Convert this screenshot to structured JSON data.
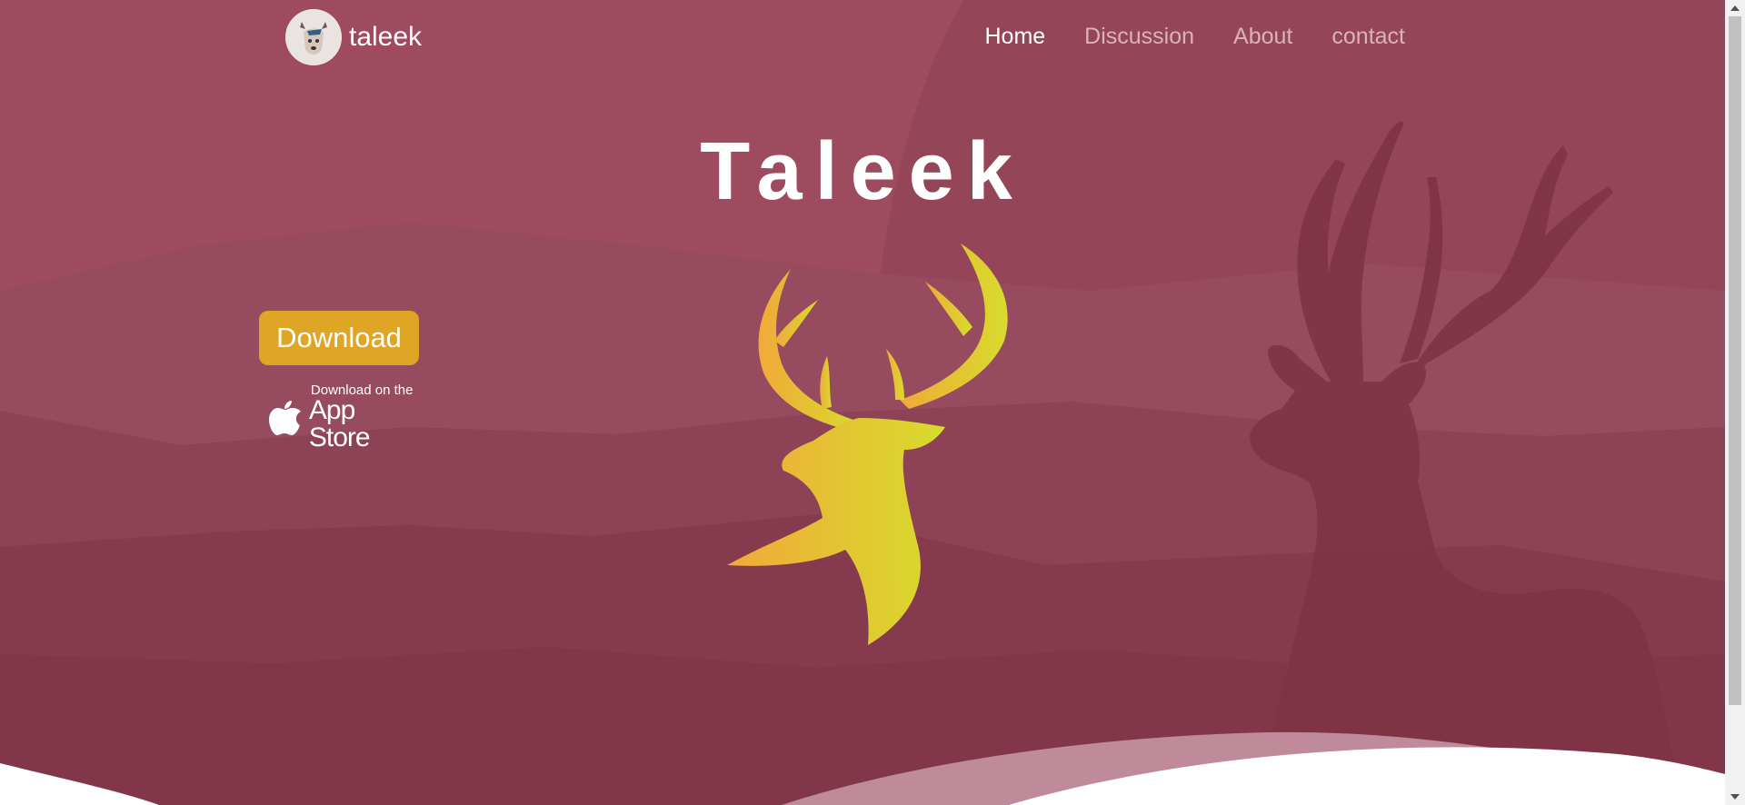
{
  "header": {
    "brand_name": "taleek",
    "brand_logo_icon": "deer-cartoon-logo-icon",
    "nav": [
      {
        "label": "Home",
        "active": true
      },
      {
        "label": "Discussion",
        "active": false
      },
      {
        "label": "About",
        "active": false
      },
      {
        "label": "contact",
        "active": false
      }
    ]
  },
  "hero": {
    "title": "Taleek",
    "emblem_icon": "deer-head-icon",
    "download_label": "Download",
    "appstore": {
      "icon": "apple-icon",
      "small_text": "Download on the",
      "big_text": "App Store"
    }
  },
  "colors": {
    "background": "#8a3a50",
    "accent": "#dfa524",
    "nav_inactive": "#d9b2bc",
    "nav_active": "#ffffff"
  }
}
